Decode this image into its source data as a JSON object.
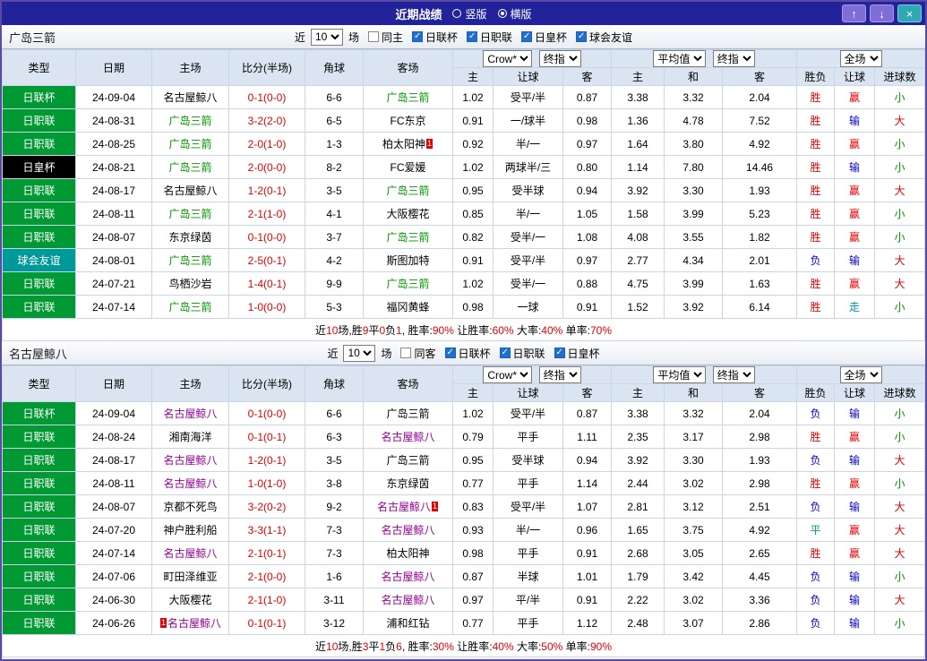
{
  "titlebar": {
    "title": "近期战绩",
    "orientation": {
      "vertical_label": "竖版",
      "horizontal_label": "横版",
      "vertical_selected": false,
      "horizontal_selected": true
    },
    "buttons": {
      "up": "↑",
      "down": "↓",
      "close": "×"
    }
  },
  "table_columns": {
    "type": "类型",
    "date": "日期",
    "home": "主场",
    "score": "比分(半场)",
    "corner": "角球",
    "away": "客场",
    "sub": [
      "主",
      "让球",
      "客",
      "主",
      "和",
      "客",
      "胜负",
      "让球",
      "进球数"
    ]
  },
  "sections": [
    {
      "team": "广岛三箭",
      "filter": {
        "near_label": "近",
        "count": "10",
        "unit_label": "场",
        "checkboxes": [
          {
            "label": "同主",
            "checked": false
          },
          {
            "label": "日联杯",
            "checked": true
          },
          {
            "label": "日职联",
            "checked": true
          },
          {
            "label": "日皇杯",
            "checked": true
          },
          {
            "label": "球会友谊",
            "checked": true
          }
        ]
      },
      "selects": {
        "odds_source": "Crow*",
        "odds_time": "终指",
        "avg_source": "平均值",
        "avg_time": "终指",
        "scope": "全场"
      },
      "rows": [
        {
          "type": "日联杯",
          "type_bg": "green",
          "date": "24-09-04",
          "home": {
            "name": "名古屋鲸八",
            "color": "k"
          },
          "score": "0-1(0-0)",
          "corner": "6-6",
          "away": {
            "name": "广岛三箭",
            "color": "g"
          },
          "odds": [
            "1.02",
            "受平/半",
            "0.87"
          ],
          "avg": [
            "3.38",
            "3.32",
            "2.04"
          ],
          "result": {
            "t": "胜",
            "c": "r"
          },
          "handicap": {
            "t": "赢",
            "c": "r"
          },
          "goals": {
            "t": "小",
            "c": "g"
          }
        },
        {
          "type": "日职联",
          "type_bg": "green",
          "date": "24-08-31",
          "home": {
            "name": "广岛三箭",
            "color": "g"
          },
          "score": "3-2(2-0)",
          "corner": "6-5",
          "away": {
            "name": "FC东京",
            "color": "k"
          },
          "odds": [
            "0.91",
            "一/球半",
            "0.98"
          ],
          "avg": [
            "1.36",
            "4.78",
            "7.52"
          ],
          "result": {
            "t": "胜",
            "c": "r"
          },
          "handicap": {
            "t": "输",
            "c": "b"
          },
          "goals": {
            "t": "大",
            "c": "r"
          }
        },
        {
          "type": "日职联",
          "type_bg": "green",
          "date": "24-08-25",
          "home": {
            "name": "广岛三箭",
            "color": "g"
          },
          "score": "2-0(1-0)",
          "corner": "1-3",
          "away": {
            "name": "柏太阳神",
            "color": "k",
            "card": "after"
          },
          "odds": [
            "0.92",
            "半/一",
            "0.97"
          ],
          "avg": [
            "1.64",
            "3.80",
            "4.92"
          ],
          "result": {
            "t": "胜",
            "c": "r"
          },
          "handicap": {
            "t": "赢",
            "c": "r"
          },
          "goals": {
            "t": "小",
            "c": "g"
          }
        },
        {
          "type": "日皇杯",
          "type_bg": "black",
          "date": "24-08-21",
          "home": {
            "name": "广岛三箭",
            "color": "g"
          },
          "score": "2-0(0-0)",
          "corner": "8-2",
          "away": {
            "name": "FC爱媛",
            "color": "k"
          },
          "odds": [
            "1.02",
            "两球半/三",
            "0.80"
          ],
          "avg": [
            "1.14",
            "7.80",
            "14.46"
          ],
          "result": {
            "t": "胜",
            "c": "r"
          },
          "handicap": {
            "t": "输",
            "c": "b"
          },
          "goals": {
            "t": "小",
            "c": "g"
          }
        },
        {
          "type": "日职联",
          "type_bg": "green",
          "date": "24-08-17",
          "home": {
            "name": "名古屋鲸八",
            "color": "k"
          },
          "score": "1-2(0-1)",
          "corner": "3-5",
          "away": {
            "name": "广岛三箭",
            "color": "g"
          },
          "odds": [
            "0.95",
            "受半球",
            "0.94"
          ],
          "avg": [
            "3.92",
            "3.30",
            "1.93"
          ],
          "result": {
            "t": "胜",
            "c": "r"
          },
          "handicap": {
            "t": "赢",
            "c": "r"
          },
          "goals": {
            "t": "大",
            "c": "r"
          }
        },
        {
          "type": "日职联",
          "type_bg": "green",
          "date": "24-08-11",
          "home": {
            "name": "广岛三箭",
            "color": "g"
          },
          "score": "2-1(1-0)",
          "corner": "4-1",
          "away": {
            "name": "大阪樱花",
            "color": "k"
          },
          "odds": [
            "0.85",
            "半/一",
            "1.05"
          ],
          "avg": [
            "1.58",
            "3.99",
            "5.23"
          ],
          "result": {
            "t": "胜",
            "c": "r"
          },
          "handicap": {
            "t": "赢",
            "c": "r"
          },
          "goals": {
            "t": "小",
            "c": "g"
          }
        },
        {
          "type": "日职联",
          "type_bg": "green",
          "date": "24-08-07",
          "home": {
            "name": "东京绿茵",
            "color": "k"
          },
          "score": "0-1(0-0)",
          "corner": "3-7",
          "away": {
            "name": "广岛三箭",
            "color": "g"
          },
          "odds": [
            "0.82",
            "受半/一",
            "1.08"
          ],
          "avg": [
            "4.08",
            "3.55",
            "1.82"
          ],
          "result": {
            "t": "胜",
            "c": "r"
          },
          "handicap": {
            "t": "赢",
            "c": "r"
          },
          "goals": {
            "t": "小",
            "c": "g"
          }
        },
        {
          "type": "球会友谊",
          "type_bg": "teal",
          "date": "24-08-01",
          "home": {
            "name": "广岛三箭",
            "color": "g"
          },
          "score": "2-5(0-1)",
          "corner": "4-2",
          "away": {
            "name": "斯图加特",
            "color": "k"
          },
          "odds": [
            "0.91",
            "受平/半",
            "0.97"
          ],
          "avg": [
            "2.77",
            "4.34",
            "2.01"
          ],
          "result": {
            "t": "负",
            "c": "b"
          },
          "handicap": {
            "t": "输",
            "c": "b"
          },
          "goals": {
            "t": "大",
            "c": "r"
          }
        },
        {
          "type": "日职联",
          "type_bg": "green",
          "date": "24-07-21",
          "home": {
            "name": "鸟栖沙岩",
            "color": "k"
          },
          "score": "1-4(0-1)",
          "corner": "9-9",
          "away": {
            "name": "广岛三箭",
            "color": "g"
          },
          "odds": [
            "1.02",
            "受半/一",
            "0.88"
          ],
          "avg": [
            "4.75",
            "3.99",
            "1.63"
          ],
          "result": {
            "t": "胜",
            "c": "r"
          },
          "handicap": {
            "t": "赢",
            "c": "r"
          },
          "goals": {
            "t": "大",
            "c": "r"
          }
        },
        {
          "type": "日职联",
          "type_bg": "green",
          "date": "24-07-14",
          "home": {
            "name": "广岛三箭",
            "color": "g"
          },
          "score": "1-0(0-0)",
          "corner": "5-3",
          "away": {
            "name": "福冈黄蜂",
            "color": "k"
          },
          "odds": [
            "0.98",
            "一球",
            "0.91"
          ],
          "avg": [
            "1.52",
            "3.92",
            "6.14"
          ],
          "result": {
            "t": "胜",
            "c": "r"
          },
          "handicap": {
            "t": "走",
            "c": "t"
          },
          "goals": {
            "t": "小",
            "c": "g"
          }
        }
      ],
      "summary": [
        {
          "t": "近",
          "c": "k"
        },
        {
          "t": "10",
          "c": "r"
        },
        {
          "t": "场,胜",
          "c": "k"
        },
        {
          "t": "9",
          "c": "r"
        },
        {
          "t": "平",
          "c": "k"
        },
        {
          "t": "0",
          "c": "r"
        },
        {
          "t": "负",
          "c": "k"
        },
        {
          "t": "1",
          "c": "r"
        },
        {
          "t": ", 胜率:",
          "c": "k"
        },
        {
          "t": "90%",
          "c": "r"
        },
        {
          "t": " 让胜率:",
          "c": "k"
        },
        {
          "t": "60%",
          "c": "r"
        },
        {
          "t": " 大率:",
          "c": "k"
        },
        {
          "t": "40%",
          "c": "r"
        },
        {
          "t": " 单率:",
          "c": "k"
        },
        {
          "t": "70%",
          "c": "r"
        }
      ]
    },
    {
      "team": "名古屋鲸八",
      "filter": {
        "near_label": "近",
        "count": "10",
        "unit_label": "场",
        "checkboxes": [
          {
            "label": "同客",
            "checked": false
          },
          {
            "label": "日联杯",
            "checked": true
          },
          {
            "label": "日职联",
            "checked": true
          },
          {
            "label": "日皇杯",
            "checked": true
          }
        ]
      },
      "selects": {
        "odds_source": "Crow*",
        "odds_time": "终指",
        "avg_source": "平均值",
        "avg_time": "终指",
        "scope": "全场"
      },
      "rows": [
        {
          "type": "日联杯",
          "type_bg": "green",
          "date": "24-09-04",
          "home": {
            "name": "名古屋鲸八",
            "color": "p"
          },
          "score": "0-1(0-0)",
          "corner": "6-6",
          "away": {
            "name": "广岛三箭",
            "color": "k"
          },
          "odds": [
            "1.02",
            "受平/半",
            "0.87"
          ],
          "avg": [
            "3.38",
            "3.32",
            "2.04"
          ],
          "result": {
            "t": "负",
            "c": "b"
          },
          "handicap": {
            "t": "输",
            "c": "b"
          },
          "goals": {
            "t": "小",
            "c": "g"
          }
        },
        {
          "type": "日职联",
          "type_bg": "green",
          "date": "24-08-24",
          "home": {
            "name": "湘南海洋",
            "color": "k"
          },
          "score": "0-1(0-1)",
          "corner": "6-3",
          "away": {
            "name": "名古屋鲸八",
            "color": "p"
          },
          "odds": [
            "0.79",
            "平手",
            "1.11"
          ],
          "avg": [
            "2.35",
            "3.17",
            "2.98"
          ],
          "result": {
            "t": "胜",
            "c": "r"
          },
          "handicap": {
            "t": "赢",
            "c": "r"
          },
          "goals": {
            "t": "小",
            "c": "g"
          }
        },
        {
          "type": "日职联",
          "type_bg": "green",
          "date": "24-08-17",
          "home": {
            "name": "名古屋鲸八",
            "color": "p"
          },
          "score": "1-2(0-1)",
          "corner": "3-5",
          "away": {
            "name": "广岛三箭",
            "color": "k"
          },
          "odds": [
            "0.95",
            "受半球",
            "0.94"
          ],
          "avg": [
            "3.92",
            "3.30",
            "1.93"
          ],
          "result": {
            "t": "负",
            "c": "b"
          },
          "handicap": {
            "t": "输",
            "c": "b"
          },
          "goals": {
            "t": "大",
            "c": "r"
          }
        },
        {
          "type": "日职联",
          "type_bg": "green",
          "date": "24-08-11",
          "home": {
            "name": "名古屋鲸八",
            "color": "p"
          },
          "score": "1-0(1-0)",
          "corner": "3-8",
          "away": {
            "name": "东京绿茵",
            "color": "k"
          },
          "odds": [
            "0.77",
            "平手",
            "1.14"
          ],
          "avg": [
            "2.44",
            "3.02",
            "2.98"
          ],
          "result": {
            "t": "胜",
            "c": "r"
          },
          "handicap": {
            "t": "赢",
            "c": "r"
          },
          "goals": {
            "t": "小",
            "c": "g"
          }
        },
        {
          "type": "日职联",
          "type_bg": "green",
          "date": "24-08-07",
          "home": {
            "name": "京都不死鸟",
            "color": "k"
          },
          "score": "3-2(0-2)",
          "corner": "9-2",
          "away": {
            "name": "名古屋鲸八",
            "color": "p",
            "card": "after"
          },
          "odds": [
            "0.83",
            "受平/半",
            "1.07"
          ],
          "avg": [
            "2.81",
            "3.12",
            "2.51"
          ],
          "result": {
            "t": "负",
            "c": "b"
          },
          "handicap": {
            "t": "输",
            "c": "b"
          },
          "goals": {
            "t": "大",
            "c": "r"
          }
        },
        {
          "type": "日职联",
          "type_bg": "green",
          "date": "24-07-20",
          "home": {
            "name": "神户胜利船",
            "color": "k"
          },
          "score": "3-3(1-1)",
          "corner": "7-3",
          "away": {
            "name": "名古屋鲸八",
            "color": "p"
          },
          "odds": [
            "0.93",
            "半/一",
            "0.96"
          ],
          "avg": [
            "1.65",
            "3.75",
            "4.92"
          ],
          "result": {
            "t": "平",
            "c": "t"
          },
          "handicap": {
            "t": "赢",
            "c": "r"
          },
          "goals": {
            "t": "大",
            "c": "r"
          }
        },
        {
          "type": "日职联",
          "type_bg": "green",
          "date": "24-07-14",
          "home": {
            "name": "名古屋鲸八",
            "color": "p"
          },
          "score": "2-1(0-1)",
          "corner": "7-3",
          "away": {
            "name": "柏太阳神",
            "color": "k"
          },
          "odds": [
            "0.98",
            "平手",
            "0.91"
          ],
          "avg": [
            "2.68",
            "3.05",
            "2.65"
          ],
          "result": {
            "t": "胜",
            "c": "r"
          },
          "handicap": {
            "t": "赢",
            "c": "r"
          },
          "goals": {
            "t": "大",
            "c": "r"
          }
        },
        {
          "type": "日职联",
          "type_bg": "green",
          "date": "24-07-06",
          "home": {
            "name": "町田泽维亚",
            "color": "k"
          },
          "score": "2-1(0-0)",
          "corner": "1-6",
          "away": {
            "name": "名古屋鲸八",
            "color": "p"
          },
          "odds": [
            "0.87",
            "半球",
            "1.01"
          ],
          "avg": [
            "1.79",
            "3.42",
            "4.45"
          ],
          "result": {
            "t": "负",
            "c": "b"
          },
          "handicap": {
            "t": "输",
            "c": "b"
          },
          "goals": {
            "t": "小",
            "c": "g"
          }
        },
        {
          "type": "日职联",
          "type_bg": "green",
          "date": "24-06-30",
          "home": {
            "name": "大阪樱花",
            "color": "k"
          },
          "score": "2-1(1-0)",
          "corner": "3-11",
          "away": {
            "name": "名古屋鲸八",
            "color": "p"
          },
          "odds": [
            "0.97",
            "平/半",
            "0.91"
          ],
          "avg": [
            "2.22",
            "3.02",
            "3.36"
          ],
          "result": {
            "t": "负",
            "c": "b"
          },
          "handicap": {
            "t": "输",
            "c": "b"
          },
          "goals": {
            "t": "大",
            "c": "r"
          }
        },
        {
          "type": "日职联",
          "type_bg": "green",
          "date": "24-06-26",
          "home": {
            "name": "名古屋鲸八",
            "color": "p",
            "card": "before"
          },
          "score": "0-1(0-1)",
          "corner": "3-12",
          "away": {
            "name": "浦和红钻",
            "color": "k"
          },
          "odds": [
            "0.77",
            "平手",
            "1.12"
          ],
          "avg": [
            "2.48",
            "3.07",
            "2.86"
          ],
          "result": {
            "t": "负",
            "c": "b"
          },
          "handicap": {
            "t": "输",
            "c": "b"
          },
          "goals": {
            "t": "小",
            "c": "g"
          }
        }
      ],
      "summary": [
        {
          "t": "近",
          "c": "k"
        },
        {
          "t": "10",
          "c": "r"
        },
        {
          "t": "场,胜",
          "c": "k"
        },
        {
          "t": "3",
          "c": "r"
        },
        {
          "t": "平",
          "c": "k"
        },
        {
          "t": "1",
          "c": "r"
        },
        {
          "t": "负",
          "c": "k"
        },
        {
          "t": "6",
          "c": "r"
        },
        {
          "t": ", 胜率:",
          "c": "k"
        },
        {
          "t": "30%",
          "c": "r"
        },
        {
          "t": " 让胜率:",
          "c": "k"
        },
        {
          "t": "40%",
          "c": "r"
        },
        {
          "t": " 大率:",
          "c": "k"
        },
        {
          "t": "50%",
          "c": "r"
        },
        {
          "t": " 单率:",
          "c": "k"
        },
        {
          "t": "90%",
          "c": "r"
        }
      ]
    }
  ]
}
